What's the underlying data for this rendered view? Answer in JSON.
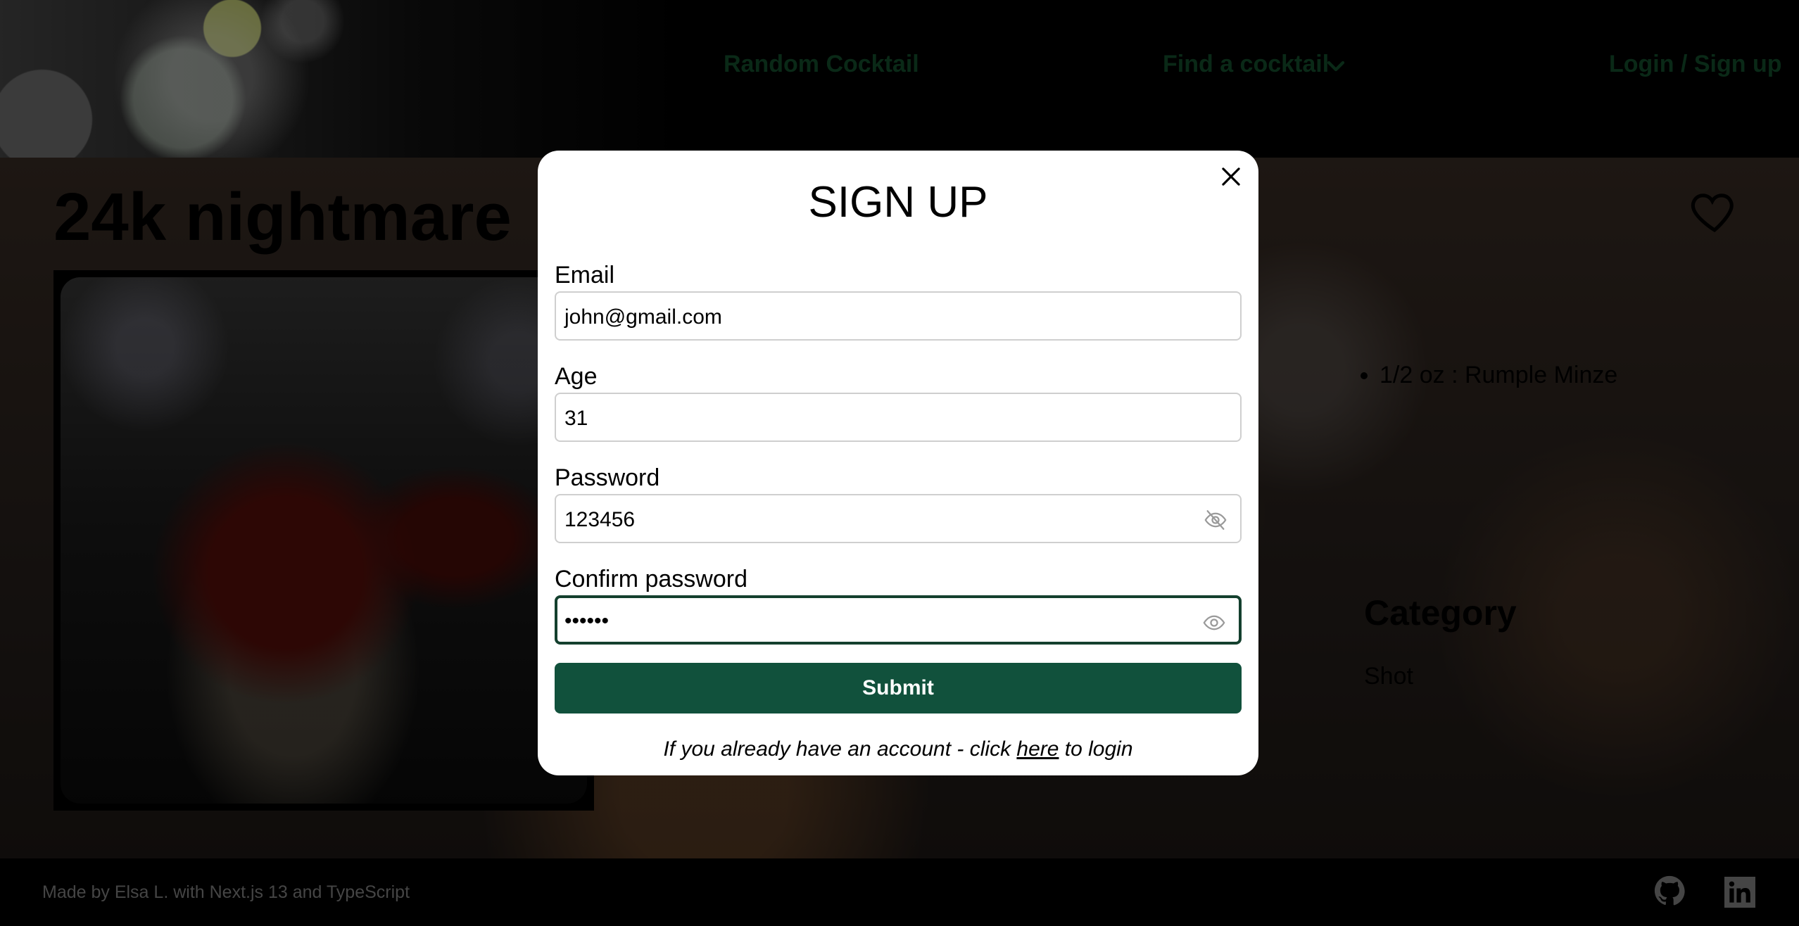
{
  "nav": {
    "random": "Random Cocktail",
    "find": "Find a cocktail",
    "login": "Login / Sign up"
  },
  "drink": {
    "name": "24k nightmare",
    "ingredients": [
      "1/2 oz : Rumple Minze"
    ],
    "category_heading": "Category",
    "category_value": "Shot"
  },
  "footer": {
    "text": "Made by Elsa L. with Next.js 13 and TypeScript"
  },
  "modal": {
    "title": "SIGN UP",
    "email_label": "Email",
    "email_value": "john@gmail.com",
    "age_label": "Age",
    "age_value": "31",
    "password_label": "Password",
    "password_value": "123456",
    "confirm_label": "Confirm password",
    "confirm_value": "••••••",
    "submit": "Submit",
    "hint_before": "If you already have an account - click ",
    "hint_link": "here",
    "hint_after": " to login"
  },
  "colors": {
    "accent": "#11513c",
    "nav_text": "#14522e"
  },
  "icons": [
    "chevron-down-icon",
    "heart-icon",
    "close-icon",
    "eye-off-icon",
    "eye-icon",
    "github-icon",
    "linkedin-icon"
  ]
}
